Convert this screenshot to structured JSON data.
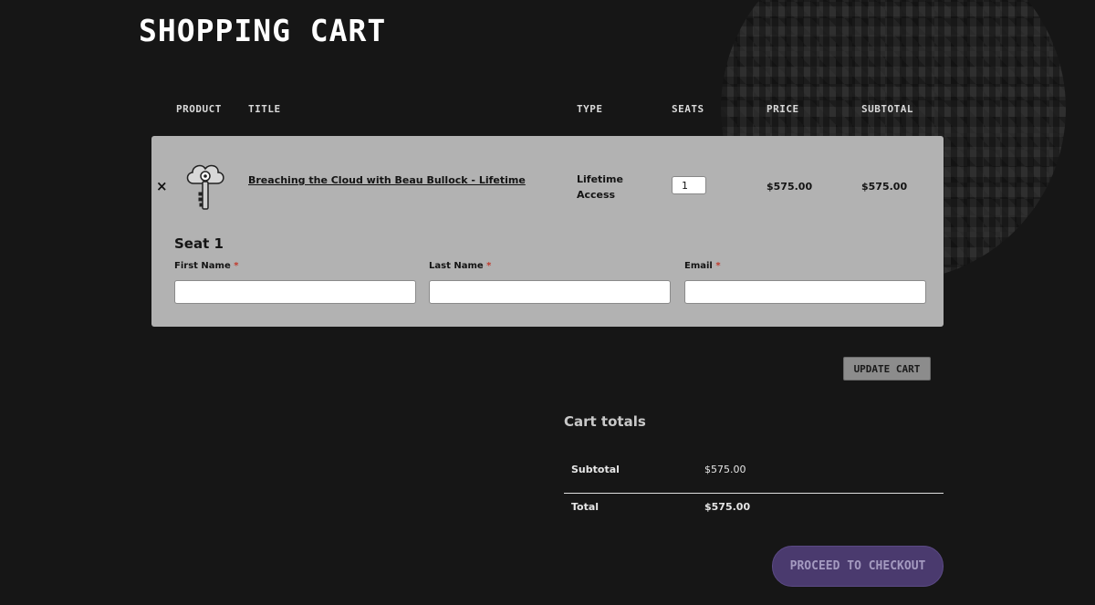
{
  "page": {
    "title": "SHOPPING CART"
  },
  "table": {
    "headers": [
      "PRODUCT",
      "TITLE",
      "TYPE",
      "SEATS",
      "PRICE",
      "SUBTOTAL"
    ]
  },
  "cart_item": {
    "remove_symbol": "×",
    "thumbnail_icon": "cloud-key-icon",
    "title": "Breaching the Cloud with Beau Bullock - Lifetime",
    "type": "Lifetime Access",
    "seats_value": "1",
    "price": "$575.00",
    "subtotal": "$575.00"
  },
  "seat_form": {
    "heading": "Seat 1",
    "required_marker": "*",
    "fields": [
      {
        "label": "First Name",
        "value": ""
      },
      {
        "label": "Last Name",
        "value": ""
      },
      {
        "label": "Email",
        "value": ""
      }
    ]
  },
  "actions": {
    "update_cart": "UPDATE CART",
    "proceed_checkout": "PROCEED TO CHECKOUT"
  },
  "totals": {
    "heading": "Cart totals",
    "subtotal_label": "Subtotal",
    "subtotal_value": "$575.00",
    "total_label": "Total",
    "total_value": "$575.00"
  },
  "colors": {
    "background": "#161616",
    "card": "#b2b2b2",
    "checkout_button": "#4a3a6e",
    "required": "#c0392b"
  }
}
